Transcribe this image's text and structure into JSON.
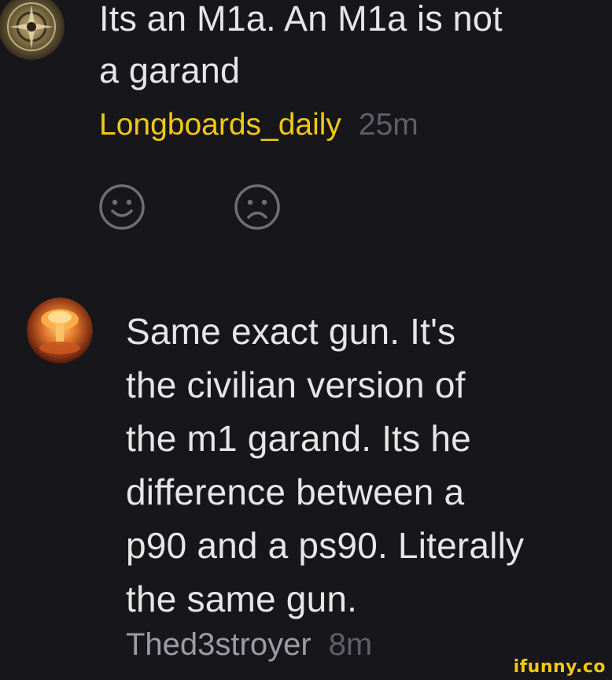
{
  "comment_1": {
    "text_line_1": "Its an M1a. An M1a is not",
    "text_line_2": "a garand",
    "username": "Longboards_daily",
    "timestamp": "25m"
  },
  "reactions": {
    "like_icon": "smile-icon",
    "dislike_icon": "frown-icon"
  },
  "comment_2": {
    "lines": [
      "Same exact gun. It's",
      "the civilian version of",
      "the m1 garand. Its he",
      "difference between a",
      "p90 and a ps90. Literally",
      "the same gun."
    ],
    "username": "Thed3stroyer",
    "timestamp": "8m"
  },
  "watermark": "ifunny.co",
  "colors": {
    "background": "#16161b",
    "username_accent": "#f2c813",
    "timestamp": "#5f5f66",
    "icon_stroke": "#6e6e74"
  }
}
